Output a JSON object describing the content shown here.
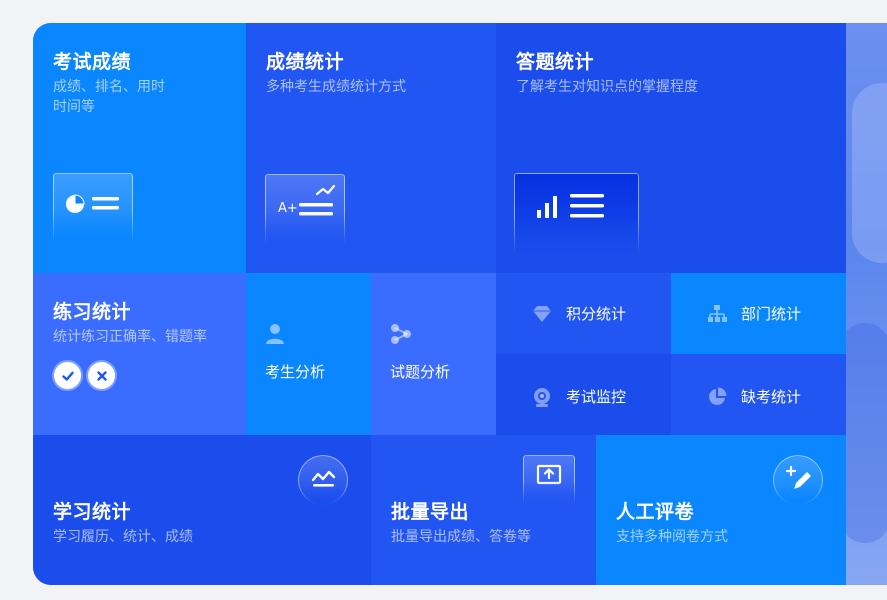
{
  "tiles": {
    "exam_score": {
      "title": "考试成绩",
      "sub1": "成绩、排名、用时",
      "sub2": "时间等"
    },
    "score_stats": {
      "title": "成绩统计",
      "sub": "多种考生成绩统计方式"
    },
    "answer_stats": {
      "title": "答题统计",
      "sub": "了解考生对知识点的掌握程度"
    },
    "practice_stats": {
      "title": "练习统计",
      "sub": "统计练习正确率、错题率"
    },
    "examinee_analysis": {
      "label": "考生分析"
    },
    "question_analysis": {
      "label": "试题分析"
    },
    "points_stats": {
      "label": "积分统计"
    },
    "dept_stats": {
      "label": "部门统计"
    },
    "exam_monitor": {
      "label": "考试监控"
    },
    "absence_stats": {
      "label": "缺考统计"
    },
    "learning_stats": {
      "title": "学习统计",
      "sub": "学习履历、统计、成绩"
    },
    "batch_export": {
      "title": "批量导出",
      "sub": "批量导出成绩、答卷等"
    },
    "manual_grading": {
      "title": "人工评卷",
      "sub": "支持多种阅卷方式"
    }
  },
  "colors": {
    "tile_cyan": "#0a86ff",
    "tile_blue": "#2256f2",
    "tile_deep": "#1b4ded",
    "tile_light": "#3a6cff",
    "page_bg": "#f2f3f5"
  }
}
